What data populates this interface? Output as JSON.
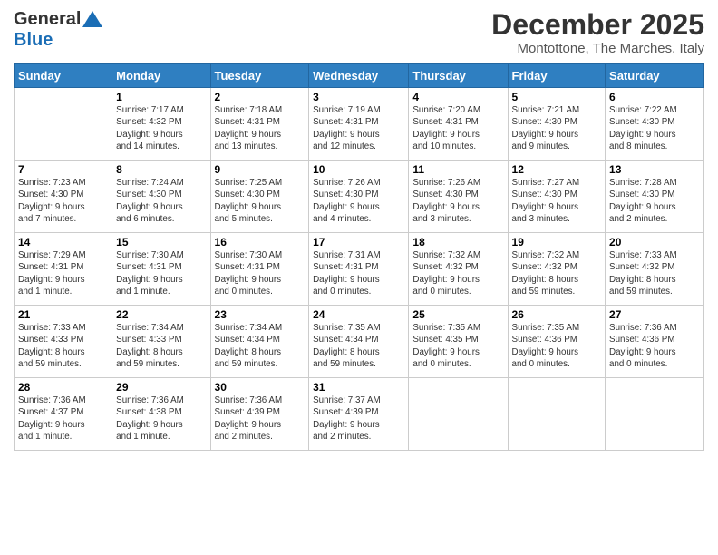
{
  "logo": {
    "general": "General",
    "blue": "Blue"
  },
  "title": "December 2025",
  "location": "Montottone, The Marches, Italy",
  "headers": [
    "Sunday",
    "Monday",
    "Tuesday",
    "Wednesday",
    "Thursday",
    "Friday",
    "Saturday"
  ],
  "weeks": [
    [
      {
        "num": "",
        "info": ""
      },
      {
        "num": "1",
        "info": "Sunrise: 7:17 AM\nSunset: 4:32 PM\nDaylight: 9 hours\nand 14 minutes."
      },
      {
        "num": "2",
        "info": "Sunrise: 7:18 AM\nSunset: 4:31 PM\nDaylight: 9 hours\nand 13 minutes."
      },
      {
        "num": "3",
        "info": "Sunrise: 7:19 AM\nSunset: 4:31 PM\nDaylight: 9 hours\nand 12 minutes."
      },
      {
        "num": "4",
        "info": "Sunrise: 7:20 AM\nSunset: 4:31 PM\nDaylight: 9 hours\nand 10 minutes."
      },
      {
        "num": "5",
        "info": "Sunrise: 7:21 AM\nSunset: 4:30 PM\nDaylight: 9 hours\nand 9 minutes."
      },
      {
        "num": "6",
        "info": "Sunrise: 7:22 AM\nSunset: 4:30 PM\nDaylight: 9 hours\nand 8 minutes."
      }
    ],
    [
      {
        "num": "7",
        "info": "Sunrise: 7:23 AM\nSunset: 4:30 PM\nDaylight: 9 hours\nand 7 minutes."
      },
      {
        "num": "8",
        "info": "Sunrise: 7:24 AM\nSunset: 4:30 PM\nDaylight: 9 hours\nand 6 minutes."
      },
      {
        "num": "9",
        "info": "Sunrise: 7:25 AM\nSunset: 4:30 PM\nDaylight: 9 hours\nand 5 minutes."
      },
      {
        "num": "10",
        "info": "Sunrise: 7:26 AM\nSunset: 4:30 PM\nDaylight: 9 hours\nand 4 minutes."
      },
      {
        "num": "11",
        "info": "Sunrise: 7:26 AM\nSunset: 4:30 PM\nDaylight: 9 hours\nand 3 minutes."
      },
      {
        "num": "12",
        "info": "Sunrise: 7:27 AM\nSunset: 4:30 PM\nDaylight: 9 hours\nand 3 minutes."
      },
      {
        "num": "13",
        "info": "Sunrise: 7:28 AM\nSunset: 4:30 PM\nDaylight: 9 hours\nand 2 minutes."
      }
    ],
    [
      {
        "num": "14",
        "info": "Sunrise: 7:29 AM\nSunset: 4:31 PM\nDaylight: 9 hours\nand 1 minute."
      },
      {
        "num": "15",
        "info": "Sunrise: 7:30 AM\nSunset: 4:31 PM\nDaylight: 9 hours\nand 1 minute."
      },
      {
        "num": "16",
        "info": "Sunrise: 7:30 AM\nSunset: 4:31 PM\nDaylight: 9 hours\nand 0 minutes."
      },
      {
        "num": "17",
        "info": "Sunrise: 7:31 AM\nSunset: 4:31 PM\nDaylight: 9 hours\nand 0 minutes."
      },
      {
        "num": "18",
        "info": "Sunrise: 7:32 AM\nSunset: 4:32 PM\nDaylight: 9 hours\nand 0 minutes."
      },
      {
        "num": "19",
        "info": "Sunrise: 7:32 AM\nSunset: 4:32 PM\nDaylight: 8 hours\nand 59 minutes."
      },
      {
        "num": "20",
        "info": "Sunrise: 7:33 AM\nSunset: 4:32 PM\nDaylight: 8 hours\nand 59 minutes."
      }
    ],
    [
      {
        "num": "21",
        "info": "Sunrise: 7:33 AM\nSunset: 4:33 PM\nDaylight: 8 hours\nand 59 minutes."
      },
      {
        "num": "22",
        "info": "Sunrise: 7:34 AM\nSunset: 4:33 PM\nDaylight: 8 hours\nand 59 minutes."
      },
      {
        "num": "23",
        "info": "Sunrise: 7:34 AM\nSunset: 4:34 PM\nDaylight: 8 hours\nand 59 minutes."
      },
      {
        "num": "24",
        "info": "Sunrise: 7:35 AM\nSunset: 4:34 PM\nDaylight: 8 hours\nand 59 minutes."
      },
      {
        "num": "25",
        "info": "Sunrise: 7:35 AM\nSunset: 4:35 PM\nDaylight: 9 hours\nand 0 minutes."
      },
      {
        "num": "26",
        "info": "Sunrise: 7:35 AM\nSunset: 4:36 PM\nDaylight: 9 hours\nand 0 minutes."
      },
      {
        "num": "27",
        "info": "Sunrise: 7:36 AM\nSunset: 4:36 PM\nDaylight: 9 hours\nand 0 minutes."
      }
    ],
    [
      {
        "num": "28",
        "info": "Sunrise: 7:36 AM\nSunset: 4:37 PM\nDaylight: 9 hours\nand 1 minute."
      },
      {
        "num": "29",
        "info": "Sunrise: 7:36 AM\nSunset: 4:38 PM\nDaylight: 9 hours\nand 1 minute."
      },
      {
        "num": "30",
        "info": "Sunrise: 7:36 AM\nSunset: 4:39 PM\nDaylight: 9 hours\nand 2 minutes."
      },
      {
        "num": "31",
        "info": "Sunrise: 7:37 AM\nSunset: 4:39 PM\nDaylight: 9 hours\nand 2 minutes."
      },
      {
        "num": "",
        "info": ""
      },
      {
        "num": "",
        "info": ""
      },
      {
        "num": "",
        "info": ""
      }
    ]
  ]
}
